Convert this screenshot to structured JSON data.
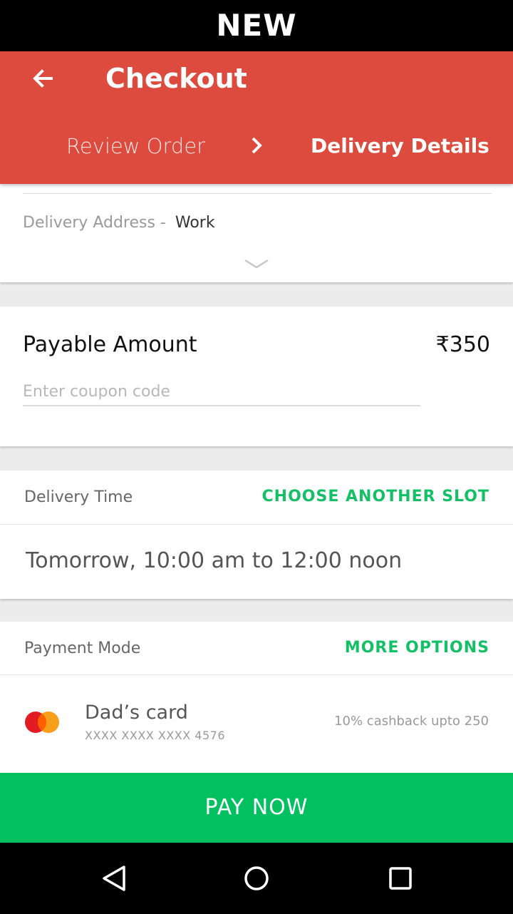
{
  "banner": {
    "text": "NEW"
  },
  "app_bar": {
    "title": "Checkout",
    "steps": [
      {
        "label": "Review Order",
        "active": false
      },
      {
        "label": "Delivery Details",
        "active": true
      }
    ],
    "color": "#dd4b3e"
  },
  "address": {
    "label": "Delivery Address -",
    "value": "Work"
  },
  "payable": {
    "label": "Payable Amount",
    "amount": "₹350",
    "coupon_placeholder": "Enter coupon code",
    "coupon_value": ""
  },
  "delivery_time": {
    "title": "Delivery Time",
    "action": "CHOOSE ANOTHER SLOT",
    "slot": "Tomorrow, 10:00 am to 12:00 noon"
  },
  "payment": {
    "title": "Payment Mode",
    "action": "MORE OPTIONS",
    "card_name": "Dad’s card",
    "card_number": "XXXX XXXX XXXX 4576",
    "card_brand": "MasterCard",
    "offer": "10% cashback upto 250"
  },
  "pay_button": {
    "label": "PAY NOW",
    "color": "#00c060"
  },
  "accent_color": "#13c066",
  "icons": [
    "back-arrow-icon",
    "chevron-right-icon",
    "chevron-down-icon",
    "mastercard-icon",
    "nav-back-icon",
    "nav-home-icon",
    "nav-recents-icon"
  ]
}
